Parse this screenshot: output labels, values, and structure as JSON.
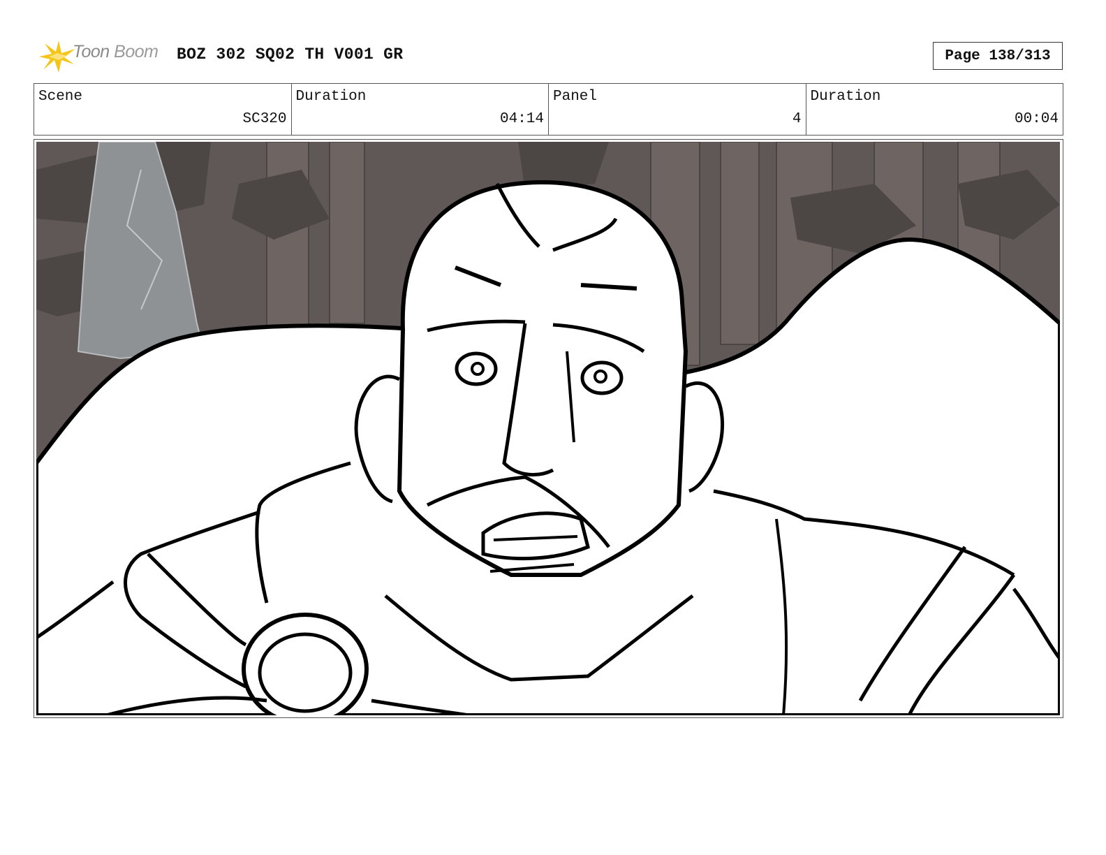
{
  "header": {
    "logo_text_1": "Toon",
    "logo_text_2": "Boom",
    "title": "BOZ 302 SQ02 TH V001 GR",
    "page": "Page 138/313"
  },
  "info": [
    {
      "label": "Scene",
      "value": "SC320"
    },
    {
      "label": "Duration",
      "value": "04:14"
    },
    {
      "label": "Panel",
      "value": "4"
    },
    {
      "label": "Duration",
      "value": "00:04"
    }
  ],
  "panel": {
    "image_icon": "storyboard-sketch-icon"
  },
  "colors": {
    "logo_yellow": "#f5c518",
    "logo_gray": "#8a8a8a",
    "bg_dark": "#5a5350",
    "rock_gray": "#8e9294"
  }
}
